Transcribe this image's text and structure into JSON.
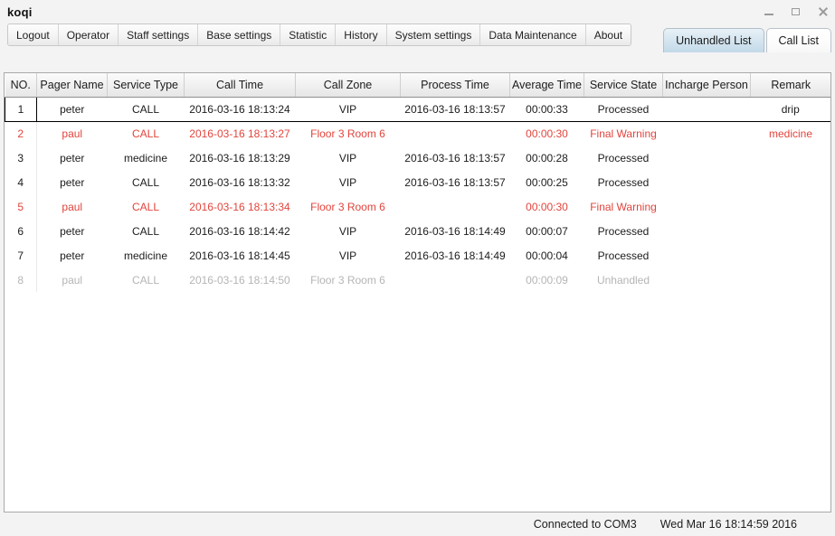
{
  "window": {
    "title": "koqi",
    "controls": [
      {
        "name": "minimize",
        "glyph": "—"
      },
      {
        "name": "maximize",
        "glyph": "□"
      },
      {
        "name": "close",
        "glyph": "✕"
      }
    ]
  },
  "menubar": {
    "items": [
      "Logout",
      "Operator",
      "Staff settings",
      "Base settings",
      "Statistic",
      "History",
      "System settings",
      "Data Maintenance",
      "About"
    ]
  },
  "tabs": [
    {
      "label": "Unhandled List",
      "active": false
    },
    {
      "label": "Call List",
      "active": true
    }
  ],
  "table": {
    "columns": [
      "NO.",
      "Pager Name",
      "Service Type",
      "Call Time",
      "Call Zone",
      "Process Time",
      "Average Time",
      "Service State",
      "Incharge Person",
      "Remark"
    ],
    "rows": [
      {
        "no": "1",
        "pager_name": "peter",
        "service_type": "CALL",
        "call_time": "2016-03-16 18:13:24",
        "call_zone": "VIP",
        "process_time": "2016-03-16 18:13:57",
        "average_time": "00:00:33",
        "service_state": "Processed",
        "incharge_person": "",
        "remark": "drip",
        "state": "normal",
        "selected": true
      },
      {
        "no": "2",
        "pager_name": "paul",
        "service_type": "CALL",
        "call_time": "2016-03-16 18:13:27",
        "call_zone": "Floor 3 Room 6",
        "process_time": "",
        "average_time": "00:00:30",
        "service_state": "Final Warning",
        "incharge_person": "",
        "remark": "medicine",
        "state": "warning",
        "selected": false
      },
      {
        "no": "3",
        "pager_name": "peter",
        "service_type": "medicine",
        "call_time": "2016-03-16 18:13:29",
        "call_zone": "VIP",
        "process_time": "2016-03-16 18:13:57",
        "average_time": "00:00:28",
        "service_state": "Processed",
        "incharge_person": "",
        "remark": "",
        "state": "normal",
        "selected": false
      },
      {
        "no": "4",
        "pager_name": "peter",
        "service_type": "CALL",
        "call_time": "2016-03-16 18:13:32",
        "call_zone": "VIP",
        "process_time": "2016-03-16 18:13:57",
        "average_time": "00:00:25",
        "service_state": "Processed",
        "incharge_person": "",
        "remark": "",
        "state": "normal",
        "selected": false
      },
      {
        "no": "5",
        "pager_name": "paul",
        "service_type": "CALL",
        "call_time": "2016-03-16 18:13:34",
        "call_zone": "Floor 3 Room 6",
        "process_time": "",
        "average_time": "00:00:30",
        "service_state": "Final Warning",
        "incharge_person": "",
        "remark": "",
        "state": "warning",
        "selected": false
      },
      {
        "no": "6",
        "pager_name": "peter",
        "service_type": "CALL",
        "call_time": "2016-03-16 18:14:42",
        "call_zone": "VIP",
        "process_time": "2016-03-16 18:14:49",
        "average_time": "00:00:07",
        "service_state": "Processed",
        "incharge_person": "",
        "remark": "",
        "state": "normal",
        "selected": false
      },
      {
        "no": "7",
        "pager_name": "peter",
        "service_type": "medicine",
        "call_time": "2016-03-16 18:14:45",
        "call_zone": "VIP",
        "process_time": "2016-03-16 18:14:49",
        "average_time": "00:00:04",
        "service_state": "Processed",
        "incharge_person": "",
        "remark": "",
        "state": "normal",
        "selected": false
      },
      {
        "no": "8",
        "pager_name": "paul",
        "service_type": "CALL",
        "call_time": "2016-03-16 18:14:50",
        "call_zone": "Floor 3 Room 6",
        "process_time": "",
        "average_time": "00:00:09",
        "service_state": "Unhandled",
        "incharge_person": "",
        "remark": "",
        "state": "unhandled",
        "selected": false
      }
    ]
  },
  "statusbar": {
    "connection": "Connected to COM3",
    "datetime": "Wed Mar 16 18:14:59 2016"
  },
  "colors": {
    "warning_red": "#e2443c",
    "unhandled_grey": "#b5b5b5",
    "tab_inactive_blue": "#d3e4ef",
    "panel_border": "#a9a9a9"
  }
}
